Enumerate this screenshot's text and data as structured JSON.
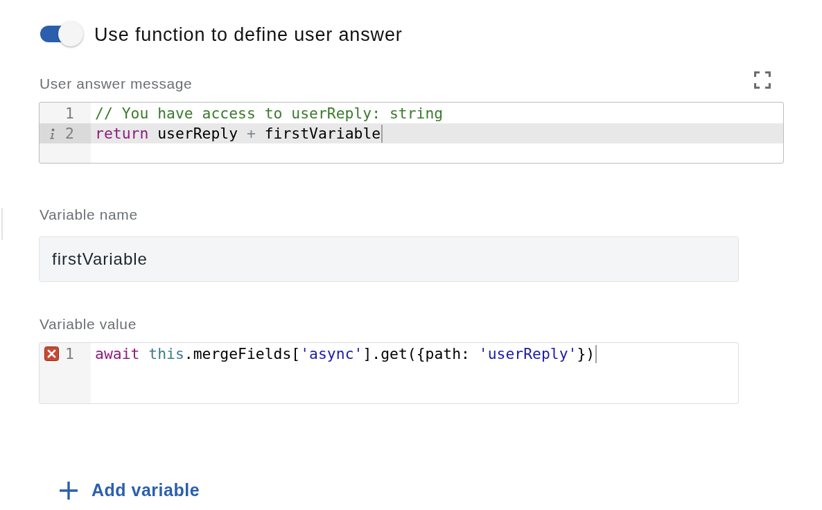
{
  "toggle": {
    "label": "Use function to define user answer",
    "on": true
  },
  "answer_message": {
    "label": "User answer message",
    "editor": {
      "lines": [
        {
          "number": "1",
          "info": false,
          "error": false,
          "active": false,
          "cursor": false,
          "tokens": [
            {
              "text": "// You have access to userReply: string",
              "kind": "comment"
            }
          ]
        },
        {
          "number": "2",
          "info": true,
          "error": false,
          "active": true,
          "cursor": true,
          "tokens": [
            {
              "text": "return",
              "kind": "keyword"
            },
            {
              "text": " userReply ",
              "kind": "plain"
            },
            {
              "text": "+",
              "kind": "operator"
            },
            {
              "text": " firstVariable",
              "kind": "plain"
            }
          ]
        }
      ]
    }
  },
  "variables": [
    {
      "name_label": "Variable name",
      "name_value": "firstVariable",
      "value_label": "Variable value",
      "editor": {
        "lines": [
          {
            "number": "1",
            "info": false,
            "error": true,
            "active": false,
            "cursor": true,
            "tokens": [
              {
                "text": "await",
                "kind": "keyword"
              },
              {
                "text": " this",
                "kind": "builtin"
              },
              {
                "text": ".mergeFields[",
                "kind": "plain"
              },
              {
                "text": "'async'",
                "kind": "string"
              },
              {
                "text": "].get({path: ",
                "kind": "plain"
              },
              {
                "text": "'userReply'",
                "kind": "string"
              },
              {
                "text": "})",
                "kind": "plain"
              }
            ]
          }
        ]
      }
    }
  ],
  "add_variable": {
    "label": "Add variable"
  }
}
